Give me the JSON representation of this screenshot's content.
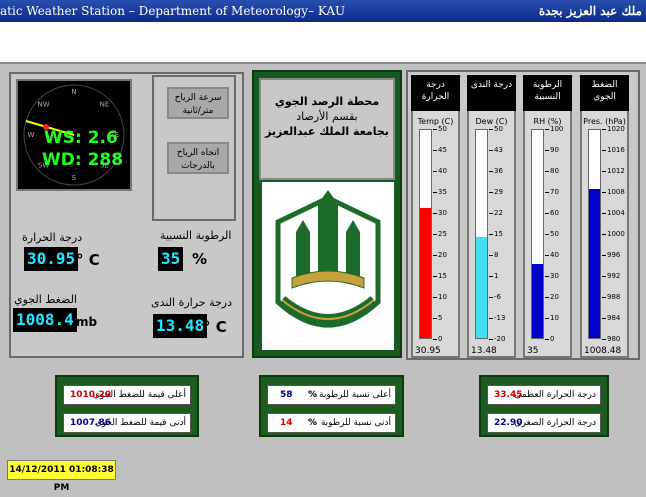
{
  "titlebar": {
    "left": "atic Weather Station – Department of Meteorology– KAU",
    "right": "ملك عبد العزيز بجدة"
  },
  "compass": {
    "ws_label": "WS: 2.6",
    "wd_label": "WD: 288",
    "dirs": [
      "N",
      "NE",
      "E",
      "SE",
      "S",
      "SW",
      "W",
      "NW"
    ]
  },
  "wind_buttons": {
    "speed": "سرعة الرياح متر/ثانية",
    "direction": "اتجاه الرياح بالدرجات"
  },
  "readings": {
    "temp_label": "درجة الحرارة",
    "temp_value": "30.95",
    "temp_unit": "° C",
    "rh_label": "الرطوبة النسبية",
    "rh_value": "35",
    "rh_unit": "%",
    "pres_label": "الضغط الجوي",
    "pres_value": "1008.4",
    "pres_unit": "mb",
    "dew_label": "درجة حرارة الندى",
    "dew_value": "13.48",
    "dew_unit": "° C"
  },
  "station": {
    "line1": "محطة الرصد الجوي",
    "line2": "بقسم الأرصاد",
    "line3": "بجامعة الملك عبدالعزيز"
  },
  "gauges": [
    {
      "header": "درجة الحرارة",
      "label": "Temp (C)",
      "value": "30.95",
      "ticks": [
        "50",
        "45",
        "40",
        "35",
        "30",
        "25",
        "20",
        "15",
        "10",
        "5",
        "0"
      ],
      "fill_frac": 0.62,
      "color": "#ff0000"
    },
    {
      "header": "درجة الندى",
      "label": "Dew (C)",
      "value": "13.48",
      "ticks": [
        "50",
        "43",
        "36",
        "29",
        "22",
        "15",
        "8",
        "1",
        "-6",
        "-13",
        "-20"
      ],
      "fill_frac": 0.48,
      "color": "#44e0f0"
    },
    {
      "header": "الرطوبة النسبية",
      "label": "RH (%)",
      "value": "35",
      "ticks": [
        "100",
        "90",
        "80",
        "70",
        "60",
        "50",
        "40",
        "30",
        "20",
        "10",
        "0"
      ],
      "fill_frac": 0.35,
      "color": "#0000cc"
    },
    {
      "header": "الضغط الجوي",
      "label": "Pres. (hPa)",
      "value": "1008.48",
      "ticks": [
        "1020",
        "1016",
        "1012",
        "1008",
        "1004",
        "1000",
        "996",
        "992",
        "988",
        "984",
        "980"
      ],
      "fill_frac": 0.71,
      "color": "#0000cc"
    }
  ],
  "minmax": {
    "pres_max_label": "أعلى قيمة للضغط الجوي",
    "pres_max": "1010.20",
    "pres_min_label": "أدنى قيمة للضغط الجوي",
    "pres_min": "1007.86",
    "rh_max_label": "أعلى نسبة للرطوبة",
    "rh_max": "58",
    "rh_unit": "%",
    "rh_min_label": "أدنى نسبة للرطوبة",
    "rh_min": "14",
    "temp_max_label": "درجة الحرارة العظمى",
    "temp_max": "33.45",
    "temp_min_label": "درجة الحرارة الصغرى",
    "temp_min": "22.90"
  },
  "timestamp": "14/12/2011 01:08:38 PM"
}
